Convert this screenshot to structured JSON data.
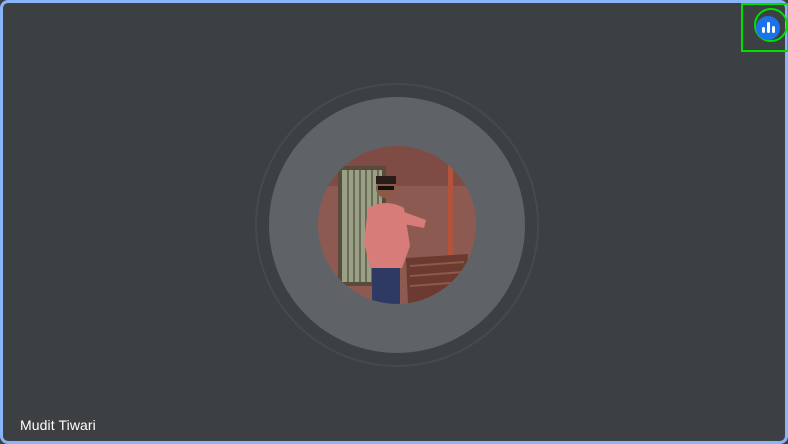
{
  "participant": {
    "name": "Mudit Tiwari"
  },
  "icons": {
    "speaking_indicator": "audio-level-bars-icon",
    "avatar": "participant-avatar"
  },
  "colors": {
    "tile_background": "#3c4043",
    "active_border": "#8ab4f8",
    "avatar_ring": "#5f6368",
    "indicator_bg": "#1a73e8",
    "highlight": "#00e000"
  }
}
